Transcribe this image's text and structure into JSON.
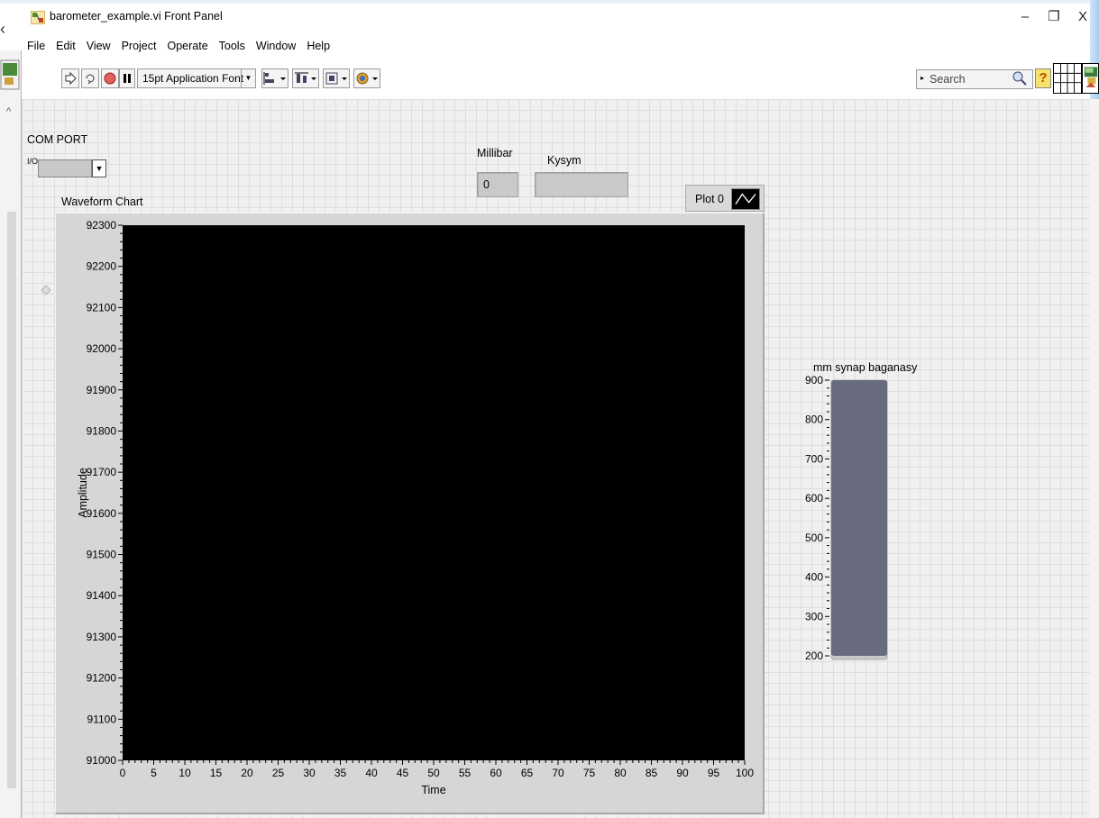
{
  "window": {
    "title": "barometer_example.vi Front Panel",
    "minimize": "–",
    "restore": "❐",
    "close": "X"
  },
  "menu": [
    "File",
    "Edit",
    "View",
    "Project",
    "Operate",
    "Tools",
    "Window",
    "Help"
  ],
  "toolbar": {
    "font_select": "15pt Application Font",
    "search_placeholder": "Search",
    "help_label": "?"
  },
  "controls": {
    "com_port": {
      "label": "COM PORT",
      "value": "",
      "icon_text": "I/O"
    },
    "millibar": {
      "label": "Millibar",
      "value": "0"
    },
    "kysym": {
      "label": "Kysym",
      "value": ""
    }
  },
  "chart_data": [
    {
      "type": "line",
      "title": "Waveform Chart",
      "xlabel": "Time",
      "ylabel": "Amplitude",
      "xlim": [
        0,
        100
      ],
      "ylim": [
        91000,
        92300
      ],
      "x_ticks": [
        0,
        5,
        10,
        15,
        20,
        25,
        30,
        35,
        40,
        45,
        50,
        55,
        60,
        65,
        70,
        75,
        80,
        85,
        90,
        95,
        100
      ],
      "y_ticks": [
        91000,
        91100,
        91200,
        91300,
        91400,
        91500,
        91600,
        91700,
        91800,
        91900,
        92000,
        92100,
        92200,
        92300
      ],
      "series": [
        {
          "name": "Plot 0",
          "values": []
        }
      ],
      "legend": "top-right",
      "plot_background": "#000000",
      "grid": false
    },
    {
      "type": "bar",
      "title": "mm synap baganasy",
      "ylim": [
        200,
        900
      ],
      "y_ticks": [
        200,
        300,
        400,
        500,
        600,
        700,
        800,
        900
      ],
      "values": [
        900
      ],
      "fill_color": "#686a7e"
    }
  ],
  "colors": {
    "panel_bg": "#f0f0f0",
    "chart_frame": "#d6d6d6",
    "plot_bg": "#000000",
    "tank_fill": "#686a7e"
  }
}
